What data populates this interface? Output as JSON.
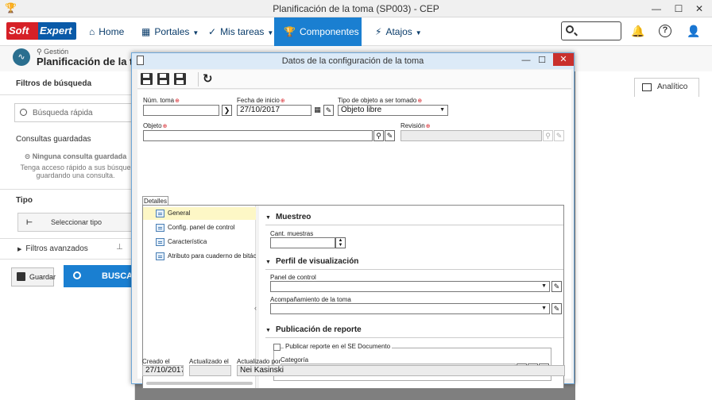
{
  "window": {
    "title": "Planificación de la toma (SP003) - CEP"
  },
  "brand": {
    "soft": "Soft",
    "expert": "Expert"
  },
  "nav": {
    "home": "Home",
    "portales": "Portales",
    "mis_tareas": "Mis tareas",
    "componentes": "Componentes",
    "atajos": "Atajos"
  },
  "page": {
    "breadcrumb": "Gestión",
    "title": "Planificación de la tom"
  },
  "leftpanel": {
    "filters_title": "Filtros de búsqueda",
    "quick_search_placeholder": "Búsqueda rápida",
    "saved_title": "Consultas guardadas",
    "no_saved": "Ninguna consulta guardada",
    "hint_line1": "Tenga acceso rápido a sus búsque",
    "hint_line2": "guardando una consulta.",
    "tipo_title": "Tipo",
    "select_type": "Seleccionar tipo",
    "advanced": "Filtros avanzados",
    "save": "Guardar",
    "search": "BUSCAR"
  },
  "right": {
    "tab_analitico": "Analítico"
  },
  "dialog": {
    "title": "Datos de la configuración de la toma",
    "fields": {
      "num_toma_label": "Núm. toma",
      "num_toma_value": "",
      "fecha_inicio_label": "Fecha de inicio",
      "fecha_inicio_value": "27/10/2017",
      "tipo_objeto_label": "Tipo de objeto a ser tomado",
      "tipo_objeto_value": "Objeto libre",
      "objeto_label": "Objeto",
      "objeto_value": "",
      "revision_label": "Revisión",
      "revision_value": ""
    },
    "tab_label": "Detalles",
    "tree": [
      "General",
      "Config. panel de control",
      "Característica",
      "Atributo para cuaderno de bitác"
    ],
    "sections": {
      "muestreo": "Muestreo",
      "cant_muestras_label": "Cant. muestras",
      "cant_muestras_value": "",
      "perfil": "Perfil de visualización",
      "panel_label": "Panel de control",
      "panel_value": "",
      "acomp_label": "Acompañamiento de la toma",
      "acomp_value": "",
      "publicacion": "Publicación de reporte",
      "publicar_label": "Publicar reporte en el SE Documento",
      "categoria_label": "Categoría",
      "categoria_value": ""
    },
    "footer": {
      "creado_label": "Creado el",
      "creado_value": "27/10/2017",
      "actualizado_label": "Actualizado el",
      "actualizado_value": "",
      "actualizado_por_label": "Actualizado por",
      "actualizado_por_value": "Nei Kasinski"
    }
  },
  "colors": {
    "accent": "#1a7fd1",
    "brand_red": "#d62027",
    "brand_blue": "#0a5aa8"
  }
}
